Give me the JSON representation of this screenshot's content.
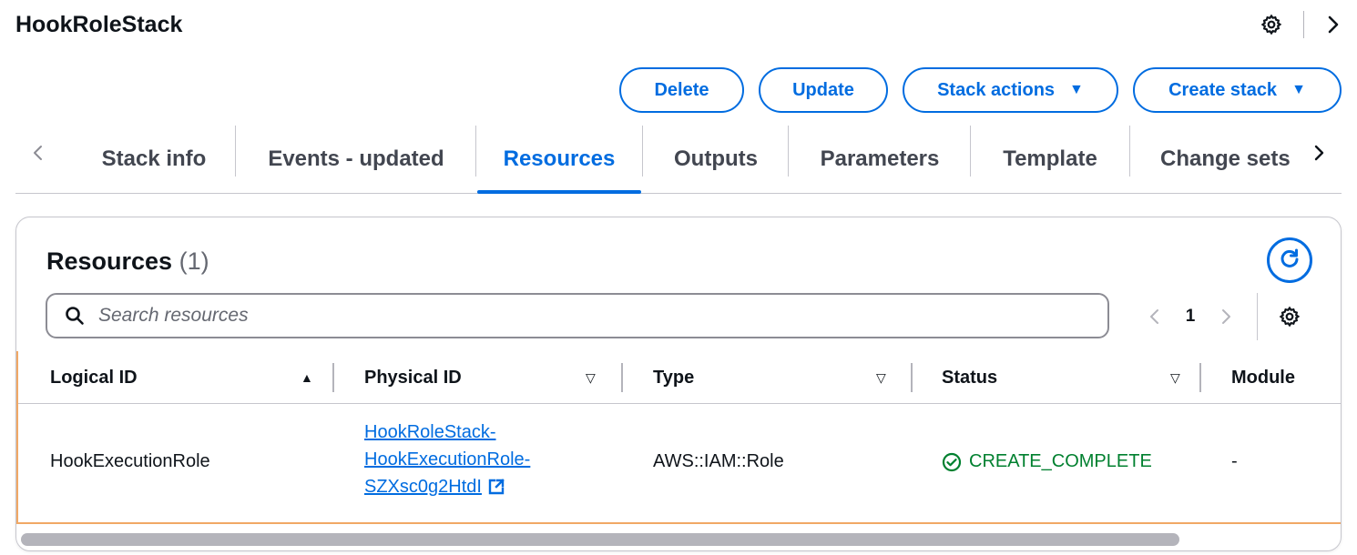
{
  "header": {
    "title": "HookRoleStack",
    "icons": [
      "gear-icon",
      "chevron-right-icon"
    ]
  },
  "actions": {
    "delete": "Delete",
    "update": "Update",
    "stack_actions": "Stack actions",
    "create_stack": "Create stack",
    "caret": "▼"
  },
  "tabs": [
    {
      "label": "Stack info",
      "active": false
    },
    {
      "label": "Events - updated",
      "active": false
    },
    {
      "label": "Resources",
      "active": true
    },
    {
      "label": "Outputs",
      "active": false
    },
    {
      "label": "Parameters",
      "active": false
    },
    {
      "label": "Template",
      "active": false
    },
    {
      "label": "Change sets",
      "active": false
    }
  ],
  "resources": {
    "title": "Resources",
    "count": "(1)",
    "search_placeholder": "Search resources",
    "page": "1",
    "columns": [
      {
        "label": "Logical ID",
        "sort": "▲"
      },
      {
        "label": "Physical ID",
        "sort": "▽"
      },
      {
        "label": "Type",
        "sort": "▽"
      },
      {
        "label": "Status",
        "sort": "▽"
      },
      {
        "label": "Module"
      }
    ],
    "rows": [
      {
        "logical_id": "HookExecutionRole",
        "physical_id_lines": [
          "HookRoleStack-",
          "HookExecutionRole-",
          "SZXsc0g2HtdI"
        ],
        "type": "AWS::IAM::Role",
        "status": "CREATE_COMPLETE",
        "module": "-"
      }
    ]
  },
  "colors": {
    "accent": "#006ce0",
    "success": "#00802f",
    "highlight_border": "#f1a865"
  }
}
